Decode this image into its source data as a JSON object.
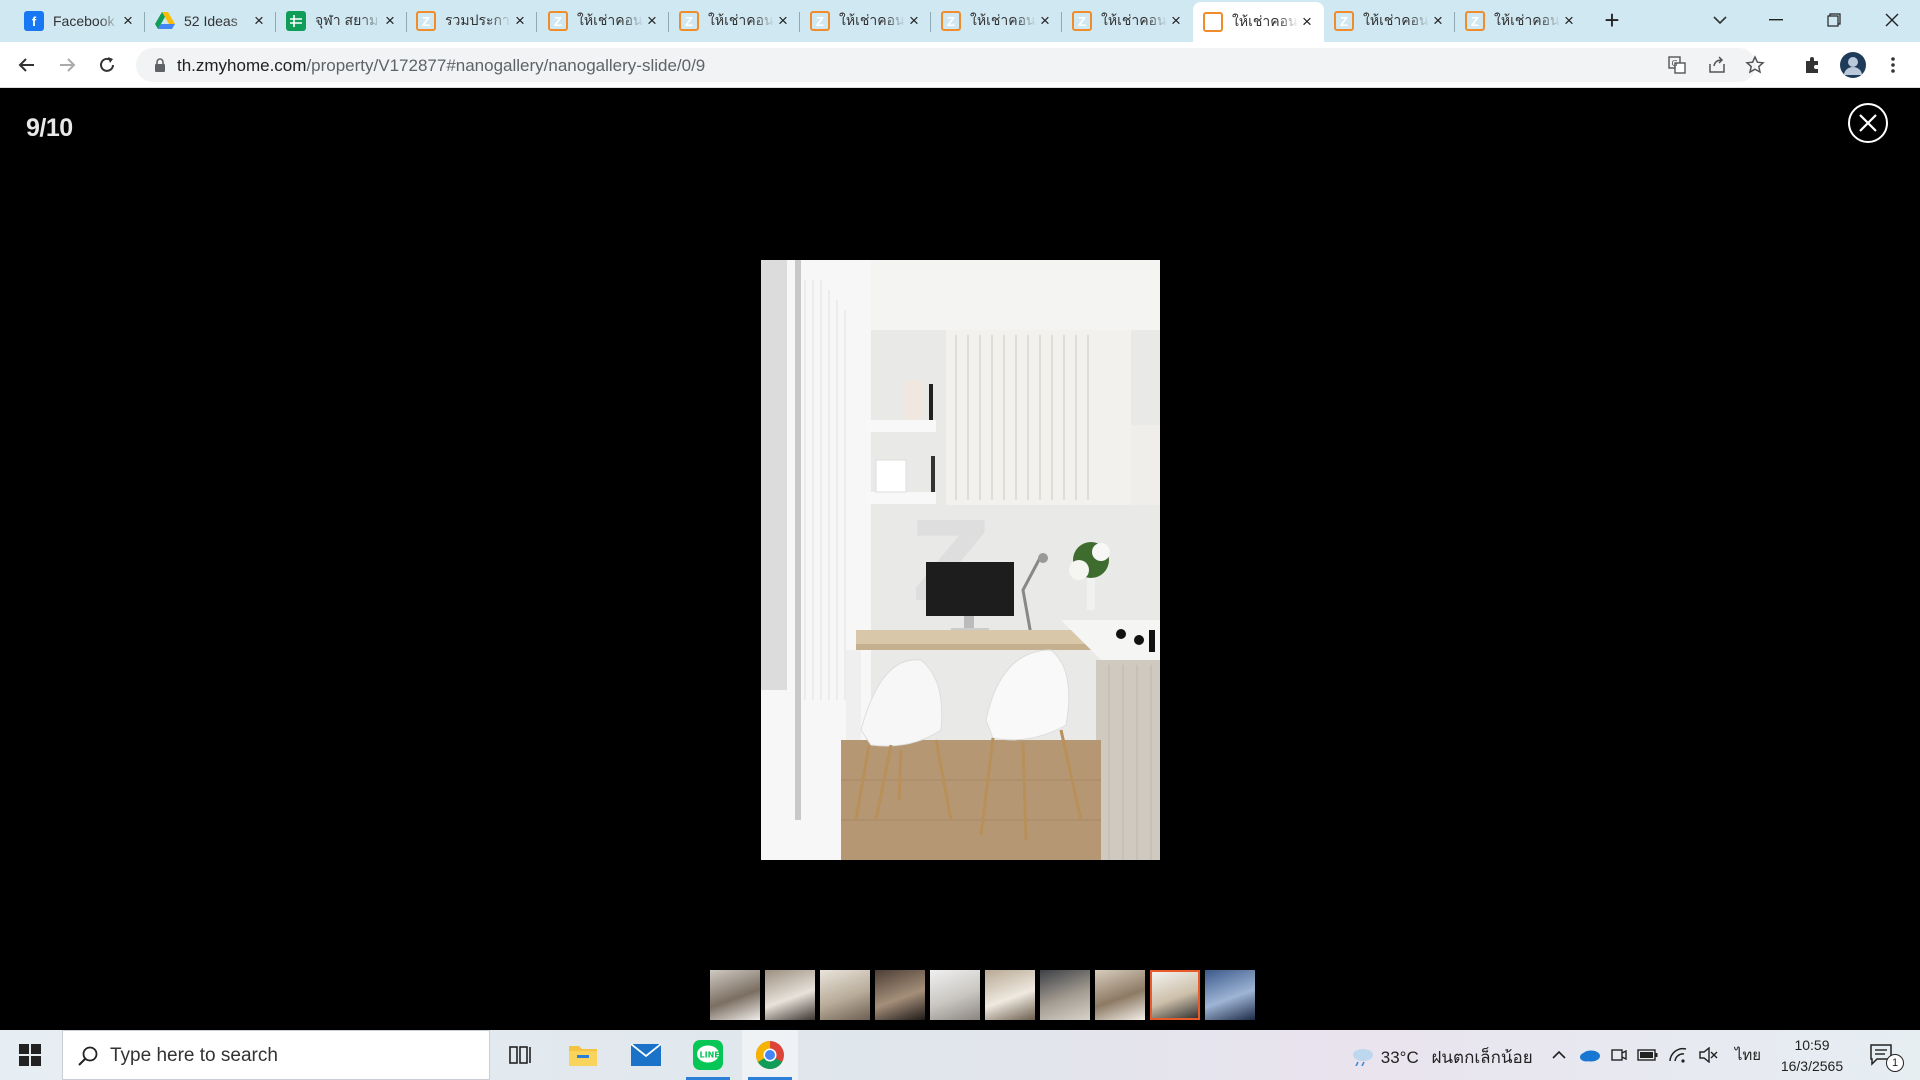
{
  "browser": {
    "tabs": [
      {
        "title": "Facebook",
        "favicon": "facebook-icon",
        "active": false
      },
      {
        "title": "52 Ideas",
        "favicon": "google-drive-icon",
        "active": false
      },
      {
        "title": "จุฬา สยาม",
        "favicon": "google-sheets-icon",
        "active": false
      },
      {
        "title": "รวมประกาศ",
        "favicon": "zmyhome-icon",
        "active": false
      },
      {
        "title": "ให้เช่าคอนโด",
        "favicon": "zmyhome-icon",
        "active": false
      },
      {
        "title": "ให้เช่าคอนโด",
        "favicon": "zmyhome-icon",
        "active": false
      },
      {
        "title": "ให้เช่าคอนโด",
        "favicon": "zmyhome-icon",
        "active": false
      },
      {
        "title": "ให้เช่าคอนโด",
        "favicon": "zmyhome-icon",
        "active": false
      },
      {
        "title": "ให้เช่าคอนโด",
        "favicon": "zmyhome-icon",
        "active": false
      },
      {
        "title": "ให้เช่าคอนโด",
        "favicon": "zmyhome-icon",
        "active": true
      },
      {
        "title": "ให้เช่าคอนโด",
        "favicon": "zmyhome-icon",
        "active": false
      },
      {
        "title": "ให้เช่าคอนโด",
        "favicon": "zmyhome-icon",
        "active": false
      }
    ],
    "url_host": "th.zmyhome.com",
    "url_path": "/property/V172877#nanogallery/nanogallery-slide/0/9"
  },
  "gallery": {
    "counter": "9/10",
    "current_index": 9,
    "total": 10,
    "thumbnail_count": 10
  },
  "taskbar": {
    "search_placeholder": "Type here to search",
    "weather_temp": "33°C",
    "weather_text": "ฝนตกเล็กน้อย",
    "language": "ไทย",
    "time": "10:59",
    "date": "16/3/2565",
    "notification_count": "1"
  },
  "colors": {
    "tabstrip": "#d0e8f2",
    "active_thumb_border": "#e85c2c",
    "zmyhome_orange": "#f08c2c"
  }
}
